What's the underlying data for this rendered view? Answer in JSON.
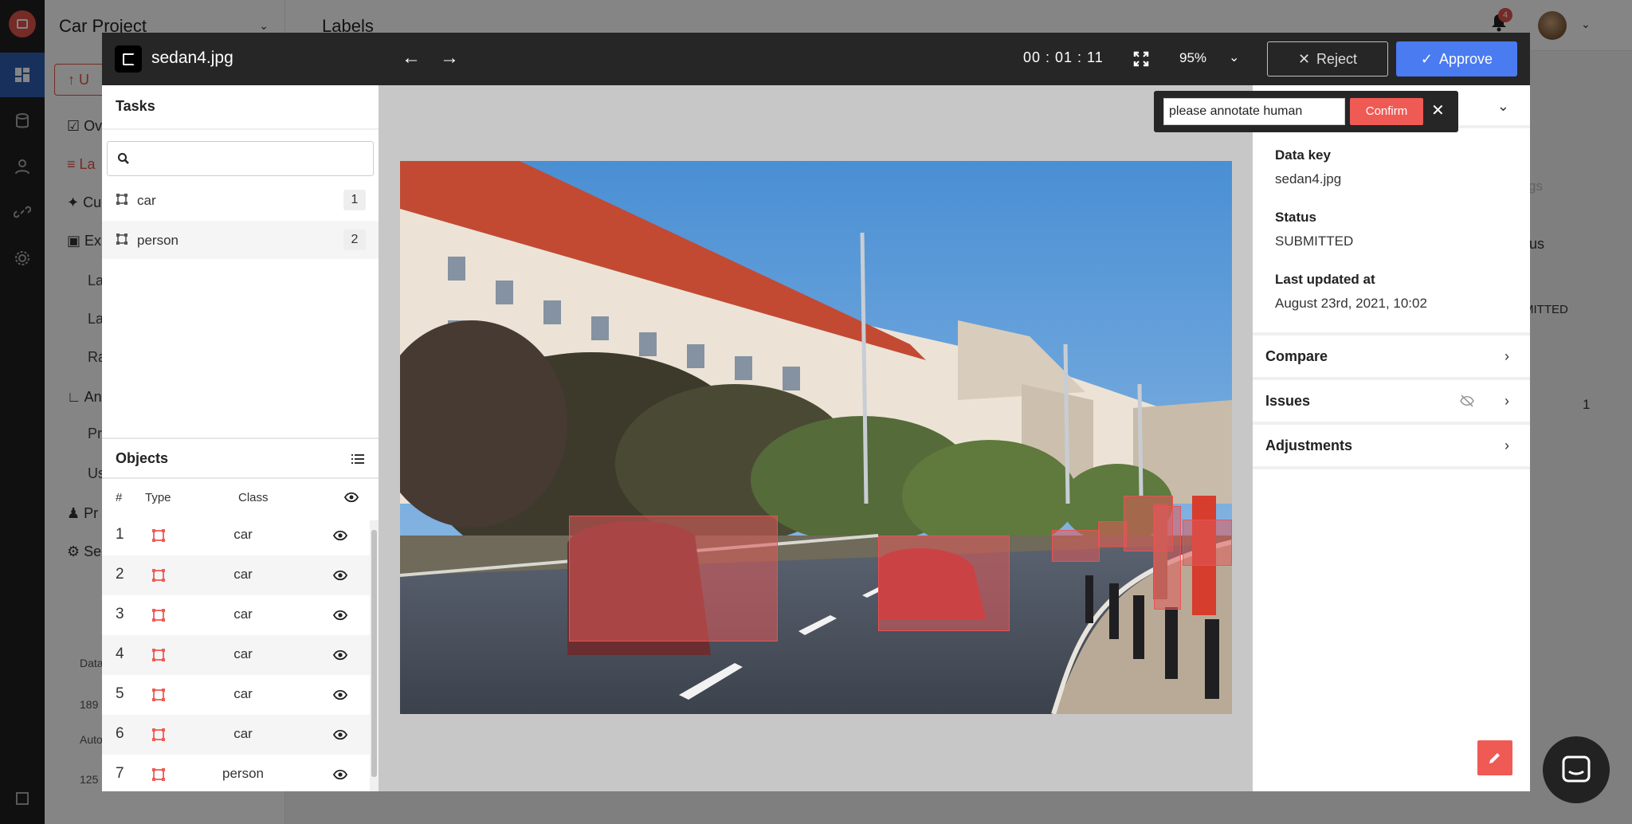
{
  "app": {
    "project_name": "Car Project",
    "upload_label": "U",
    "page_title": "Labels",
    "notification_count": "4",
    "nav": [
      {
        "label": "Ov"
      },
      {
        "label": "La"
      },
      {
        "label": "Cu"
      },
      {
        "label": "Ex"
      }
    ],
    "sub_nav": [
      "La",
      "La",
      "Ra"
    ],
    "nav2": [
      {
        "label": "An"
      }
    ],
    "sub_nav2": [
      "Pr",
      "Us"
    ],
    "nav3": [
      {
        "label": "Pr"
      },
      {
        "label": "Se"
      }
    ],
    "side_small": [
      "Data",
      "189",
      "Auto",
      "125"
    ]
  },
  "behind": {
    "status_partial": "atus",
    "submitted_partial": "MITTED",
    "tags_partial": "gs",
    "page_num": "1"
  },
  "modal": {
    "file_name": "sedan4.jpg",
    "timer": "00 : 01 : 11",
    "zoom": "95%",
    "reject_label": "Reject",
    "approve_label": "Approve"
  },
  "tasks": {
    "title": "Tasks",
    "search_placeholder": "",
    "items": [
      {
        "label": "car",
        "count": "1"
      },
      {
        "label": "person",
        "count": "2"
      }
    ]
  },
  "objects": {
    "title": "Objects",
    "columns": {
      "num": "#",
      "type": "Type",
      "class": "Class"
    },
    "rows": [
      {
        "num": "1",
        "class": "car"
      },
      {
        "num": "2",
        "class": "car"
      },
      {
        "num": "3",
        "class": "car"
      },
      {
        "num": "4",
        "class": "car"
      },
      {
        "num": "5",
        "class": "car"
      },
      {
        "num": "6",
        "class": "car"
      },
      {
        "num": "7",
        "class": "person"
      }
    ]
  },
  "details": {
    "data_key_label": "Data key",
    "data_key_value": "sedan4.jpg",
    "status_label": "Status",
    "status_value": "SUBMITTED",
    "updated_label": "Last updated at",
    "updated_value": "August 23rd, 2021, 10:02",
    "sections": [
      "Compare",
      "Issues",
      "Adjustments"
    ]
  },
  "popup": {
    "input_value": "please annotate human",
    "confirm_label": "Confirm"
  },
  "colors": {
    "accent_red": "#ef5a55",
    "approve_blue": "#4a7bf0",
    "header_dark": "#262626"
  }
}
